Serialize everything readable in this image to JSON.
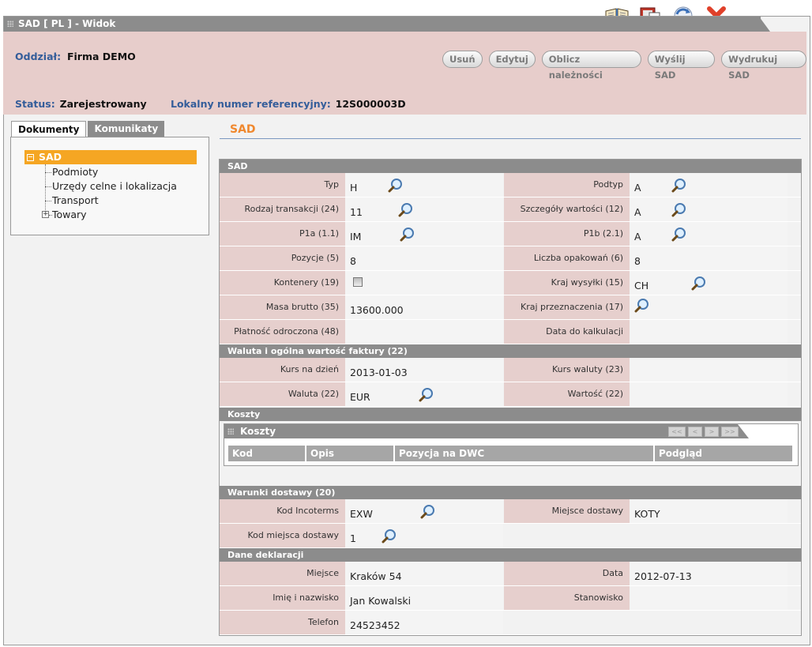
{
  "window": {
    "title": "SAD [ PL ] - Widok",
    "toolbar_icons": [
      "book-icon",
      "export-ie-icon",
      "refresh-icon",
      "close-icon"
    ]
  },
  "header": {
    "oddzial_label": "Oddział:",
    "oddzial_value": "Firma DEMO",
    "status_label": "Status:",
    "status_value": "Zarejestrowany",
    "lnr_label": "Lokalny numer referencyjny:",
    "lnr_value": "12S000003D",
    "buttons": {
      "usun": "Usuń",
      "edytuj": "Edytuj",
      "oblicz": "Oblicz należności",
      "wyslij": "Wyślij SAD",
      "wydrukuj": "Wydrukuj SAD"
    }
  },
  "tabs": {
    "dokumenty": "Dokumenty",
    "komunikaty": "Komunikaty"
  },
  "tree": {
    "root": "SAD",
    "items": [
      "Podmioty",
      "Urzędy celne i lokalizacja",
      "Transport",
      "Towary"
    ]
  },
  "section_title": "SAD",
  "sad": {
    "bar": "SAD",
    "typ_label": "Typ",
    "typ_value": "H",
    "podtyp_label": "Podtyp",
    "podtyp_value": "A",
    "rodzaj_label": "Rodzaj transakcji (24)",
    "rodzaj_value": "11",
    "szczegoly_label": "Szczegóły wartości (12)",
    "szczegoly_value": "A",
    "p1a_label": "P1a (1.1)",
    "p1a_value": "IM",
    "p1b_label": "P1b (2.1)",
    "p1b_value": "A",
    "pozycje_label": "Pozycje (5)",
    "pozycje_value": "8",
    "opakowan_label": "Liczba opakowań (6)",
    "opakowan_value": "8",
    "kontenery_label": "Kontenery (19)",
    "kraj_wysylki_label": "Kraj wysyłki (15)",
    "kraj_wysylki_value": "CH",
    "masa_label": "Masa brutto (35)",
    "masa_value": "13600.000",
    "kraj_przezn_label": "Kraj przeznaczenia (17)",
    "platnosc_label": "Płatność odroczona (48)",
    "data_kalk_label": "Data do kalkulacji"
  },
  "waluta": {
    "bar": "Waluta i ogólna wartość faktury (22)",
    "kurs_dzien_label": "Kurs na dzień",
    "kurs_dzien_value": "2013-01-03",
    "kurs_waluty_label": "Kurs waluty (23)",
    "waluta_label": "Waluta (22)",
    "waluta_value": "EUR",
    "wartosc_label": "Wartość (22)"
  },
  "koszty": {
    "bar": "Koszty",
    "grid_title": "Koszty",
    "pager": [
      "<<",
      "<",
      ">",
      ">>"
    ],
    "columns": [
      "Kod",
      "Opis",
      "Pozycja na DWC",
      "Podgląd"
    ]
  },
  "warunki": {
    "bar": "Warunki dostawy (20)",
    "incoterms_label": "Kod Incoterms",
    "incoterms_value": "EXW",
    "miejsce_dost_label": "Miejsce dostawy",
    "miejsce_dost_value": "KOTY",
    "kod_miejsca_label": "Kod miejsca dostawy",
    "kod_miejsca_value": "1"
  },
  "deklaracja": {
    "bar": "Dane deklaracji",
    "miejsce_label": "Miejsce",
    "miejsce_value": "Kraków 54",
    "data_label": "Data",
    "data_value": "2012-07-13",
    "imie_label": "Imię i nazwisko",
    "imie_value": "Jan Kowalski",
    "stanowisko_label": "Stanowisko",
    "telefon_label": "Telefon",
    "telefon_value": "24523452"
  }
}
